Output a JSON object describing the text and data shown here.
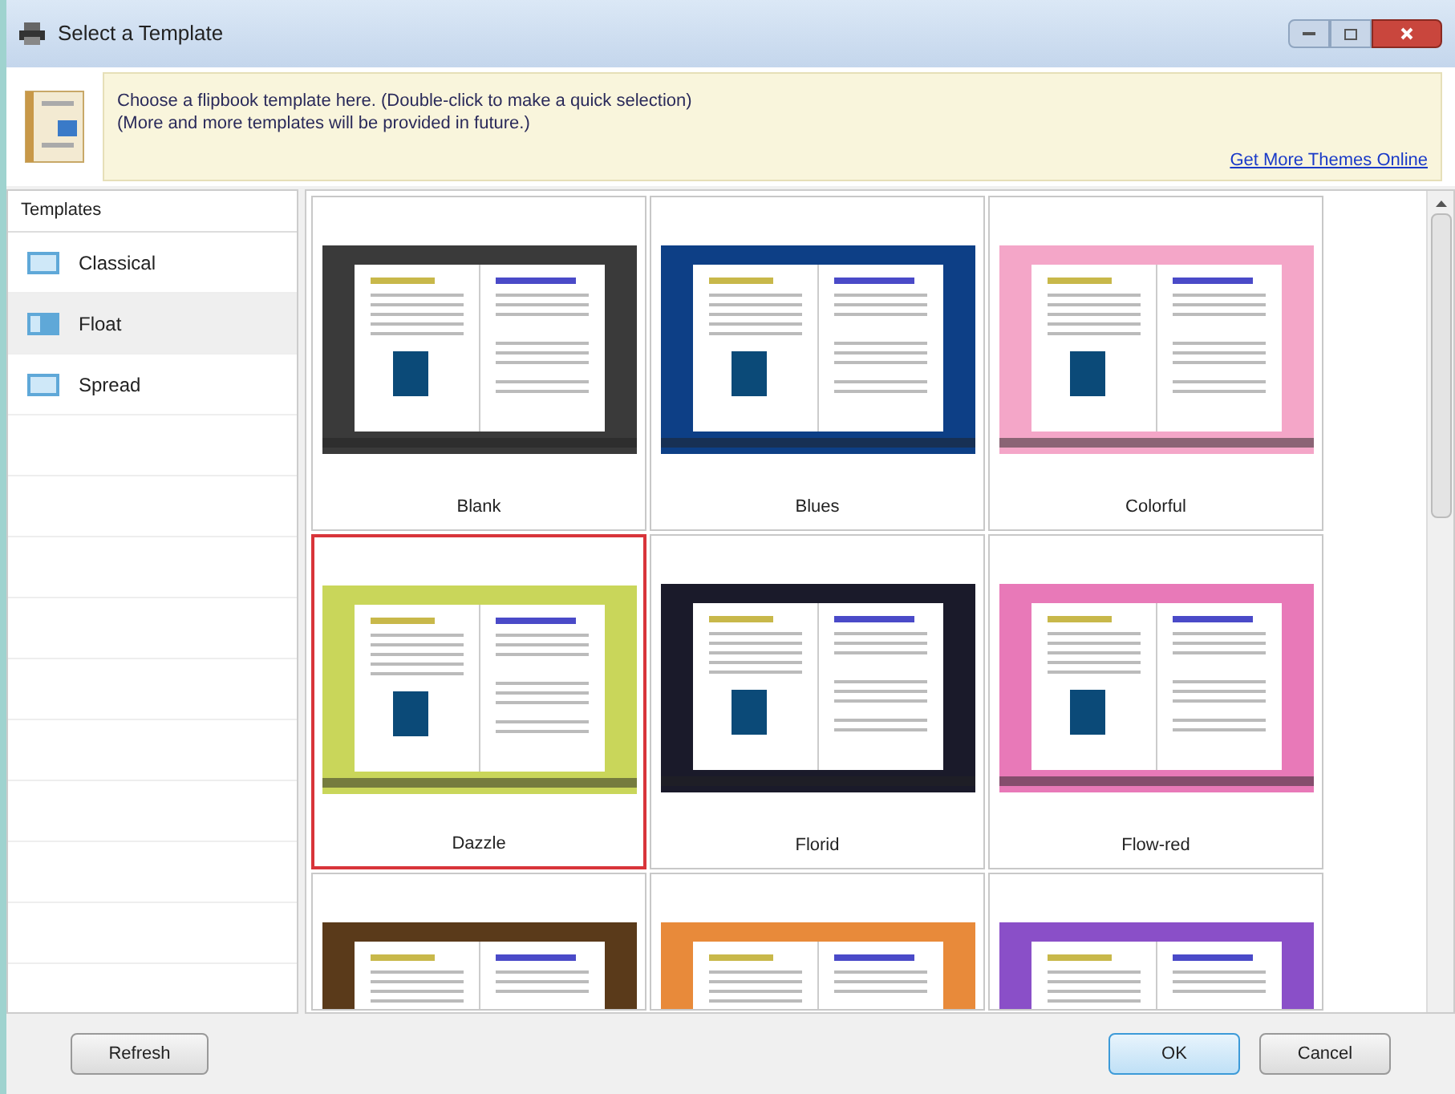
{
  "window": {
    "title": "Select a Template"
  },
  "info": {
    "lines": [
      "Choose a flipbook template here. (Double-click to make a quick selection)",
      "(More and more templates will be provided in future.)"
    ],
    "link": "Get More Themes Online"
  },
  "sidebar": {
    "header": "Templates",
    "items": [
      {
        "label": "Classical",
        "selected": false
      },
      {
        "label": "Float",
        "selected": true
      },
      {
        "label": "Spread",
        "selected": false
      }
    ]
  },
  "templates": [
    {
      "name": "Blank",
      "color": "#3a3a3a",
      "selected": false
    },
    {
      "name": "Blues",
      "color": "#0d3f86",
      "selected": false
    },
    {
      "name": "Colorful",
      "color": "#f4a6c8",
      "selected": false
    },
    {
      "name": "Dazzle",
      "color": "#c9d65a",
      "selected": true
    },
    {
      "name": "Florid",
      "color": "#1a1a2a",
      "selected": false
    },
    {
      "name": "Flow-red",
      "color": "#e879b8",
      "selected": false
    },
    {
      "color": "#5a3a1a",
      "selected": false
    },
    {
      "color": "#e88a3a",
      "selected": false
    },
    {
      "color": "#8a4fc8",
      "selected": false
    }
  ],
  "buttons": {
    "refresh": "Refresh",
    "ok": "OK",
    "cancel": "Cancel"
  }
}
